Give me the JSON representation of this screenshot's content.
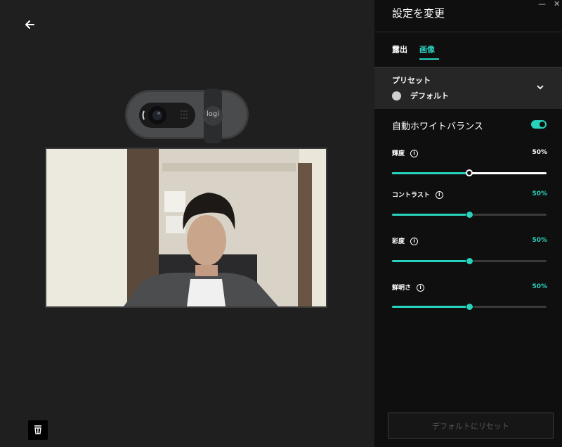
{
  "window": {
    "minimize_label": "—",
    "close_label": "✕"
  },
  "left": {
    "back_icon": "arrow-left-icon",
    "camera_brand": "logi",
    "bottom_icon": "cup-icon"
  },
  "panel": {
    "title": "設定を変更",
    "tabs": [
      {
        "label": "露出",
        "active": false
      },
      {
        "label": "画像",
        "active": true
      }
    ],
    "preset": {
      "label": "プリセット",
      "value": "デフォルト"
    },
    "auto_white_balance": {
      "label": "自動ホワイトバランス",
      "enabled": true
    },
    "sliders": [
      {
        "label": "輝度",
        "value_text": "50%",
        "value": 0.5,
        "highlight": true
      },
      {
        "label": "コントラスト",
        "value_text": "50%",
        "value": 0.5,
        "highlight": false
      },
      {
        "label": "彩度",
        "value_text": "50%",
        "value": 0.5,
        "highlight": false
      },
      {
        "label": "鮮明さ",
        "value_text": "50%",
        "value": 0.5,
        "highlight": false
      }
    ],
    "reset_label": "デフォルトにリセット"
  },
  "colors": {
    "accent": "#28d3be",
    "panel_bg": "#0f0f0f",
    "main_bg": "#1f1f1f"
  }
}
